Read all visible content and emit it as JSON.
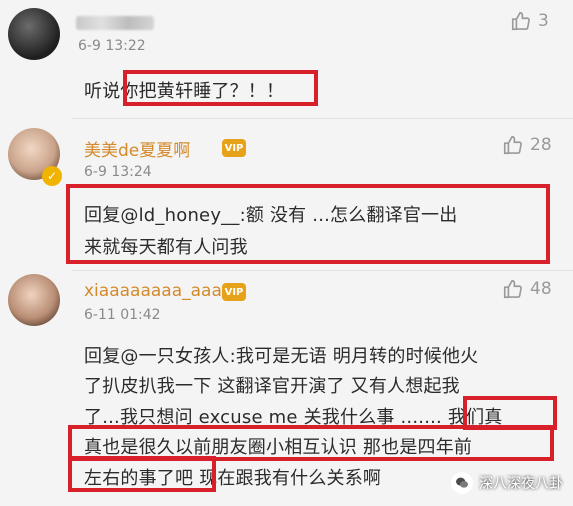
{
  "comments": [
    {
      "username": "",
      "time": "6-9 13:22",
      "likes": "3",
      "text_lines": [
        "听说你把黄轩睡了？！！"
      ]
    },
    {
      "username": "美美de夏夏啊",
      "time": "6-9 13:24",
      "likes": "28",
      "text_lines": [
        "回复@ld_honey__:额 没有 ...怎么翻译官一出",
        "来就每天都有人问我"
      ]
    },
    {
      "username": "xiaaaaaaaa_aaa",
      "time": "6-11 01:42",
      "likes": "48",
      "text_lines": [
        "回复@一只女孩人:我可是无语 明月转的时候他火",
        "了扒皮扒我一下 这翻译官开演了 又有人想起我",
        "了...我只想问 excuse me 关我什么事 ....... 我们真",
        "真也是很久以前朋友圈小相互认识 那也是四年前",
        "左右的事了吧  现在跟我有什么关系啊"
      ]
    }
  ],
  "watermark": {
    "text": "深八深夜八卦"
  },
  "colors": {
    "highlight": "#d8202a",
    "username_gold": "#d48a2c",
    "meta": "#8a8a8a"
  }
}
